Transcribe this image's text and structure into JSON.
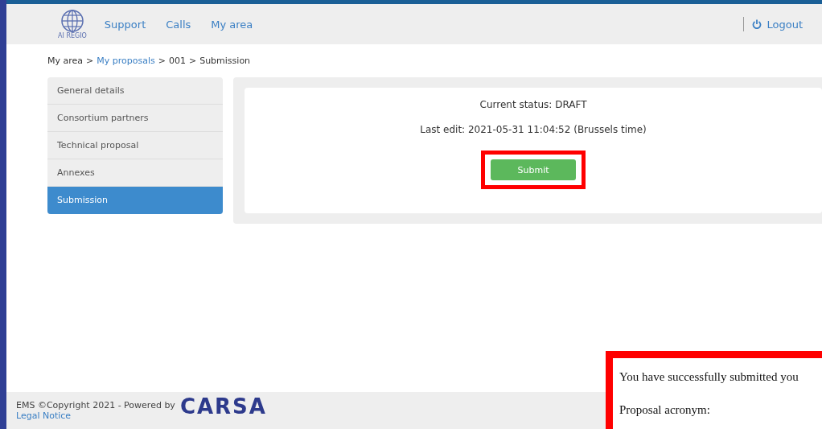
{
  "header": {
    "logo_text": "AI REGIO",
    "nav": [
      {
        "label": "Support"
      },
      {
        "label": "Calls"
      },
      {
        "label": "My area"
      }
    ],
    "logout": "Logout"
  },
  "breadcrumb": {
    "separator": ">",
    "items": [
      {
        "label": "My area",
        "link": false
      },
      {
        "label": "My proposals",
        "link": true
      },
      {
        "label": "001",
        "link": false
      },
      {
        "label": "Submission",
        "link": false
      }
    ]
  },
  "sidebar": {
    "items": [
      {
        "label": "General details",
        "selected": false
      },
      {
        "label": "Consortium partners",
        "selected": false
      },
      {
        "label": "Technical proposal",
        "selected": false
      },
      {
        "label": "Annexes",
        "selected": false
      },
      {
        "label": "Submission",
        "selected": true
      }
    ]
  },
  "status": {
    "current": "Current status: DRAFT",
    "last_edit": "Last edit: 2021-05-31 11:04:52 (Brussels time)",
    "button": "Submit"
  },
  "footer": {
    "copyright": "EMS ©Copyright 2021 - Powered by",
    "brand": "CARSA",
    "legal": "Legal Notice"
  },
  "email_overlay": {
    "lines": [
      "You have successfully submitted you",
      "Proposal acronym:"
    ]
  }
}
